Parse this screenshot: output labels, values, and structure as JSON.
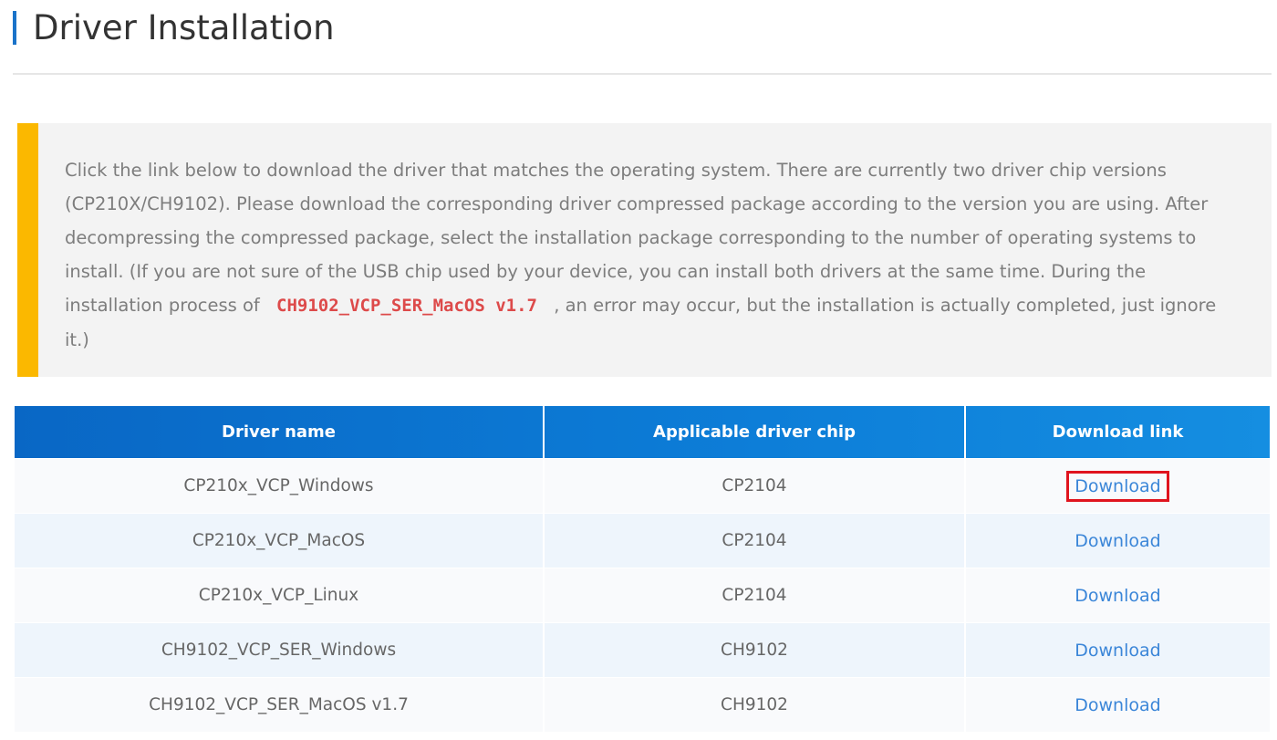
{
  "header": {
    "title": "Driver Installation",
    "accent_color": "#1a73c9"
  },
  "notice": {
    "accent_color": "#fbb800",
    "text_before": "Click the link below to download the driver that matches the operating system. There are currently two driver chip versions (CP210X/CH9102). Please download the corresponding driver compressed package according to the version you are using. After decompressing the compressed package, select the installation package corresponding to the number of operating systems to install. (If you are not sure of the USB chip used by your device, you can install both drivers at the same time. During the installation process of",
    "code": "CH9102_VCP_SER_MacOS v1.7",
    "text_after": ", an error may occur, but the installation is actually completed, just ignore it.)"
  },
  "table": {
    "columns": [
      "Driver name",
      "Applicable driver chip",
      "Download link"
    ],
    "rows": [
      {
        "name": "CP210x_VCP_Windows",
        "chip": "CP2104",
        "link": "Download",
        "highlighted": true
      },
      {
        "name": "CP210x_VCP_MacOS",
        "chip": "CP2104",
        "link": "Download",
        "highlighted": false
      },
      {
        "name": "CP210x_VCP_Linux",
        "chip": "CP2104",
        "link": "Download",
        "highlighted": false
      },
      {
        "name": "CH9102_VCP_SER_Windows",
        "chip": "CH9102",
        "link": "Download",
        "highlighted": false
      },
      {
        "name": "CH9102_VCP_SER_MacOS v1.7",
        "chip": "CH9102",
        "link": "Download",
        "highlighted": false
      }
    ],
    "header_color": "#0d7ed8",
    "link_color": "#3b86d8",
    "highlight_color": "#e0141e"
  }
}
